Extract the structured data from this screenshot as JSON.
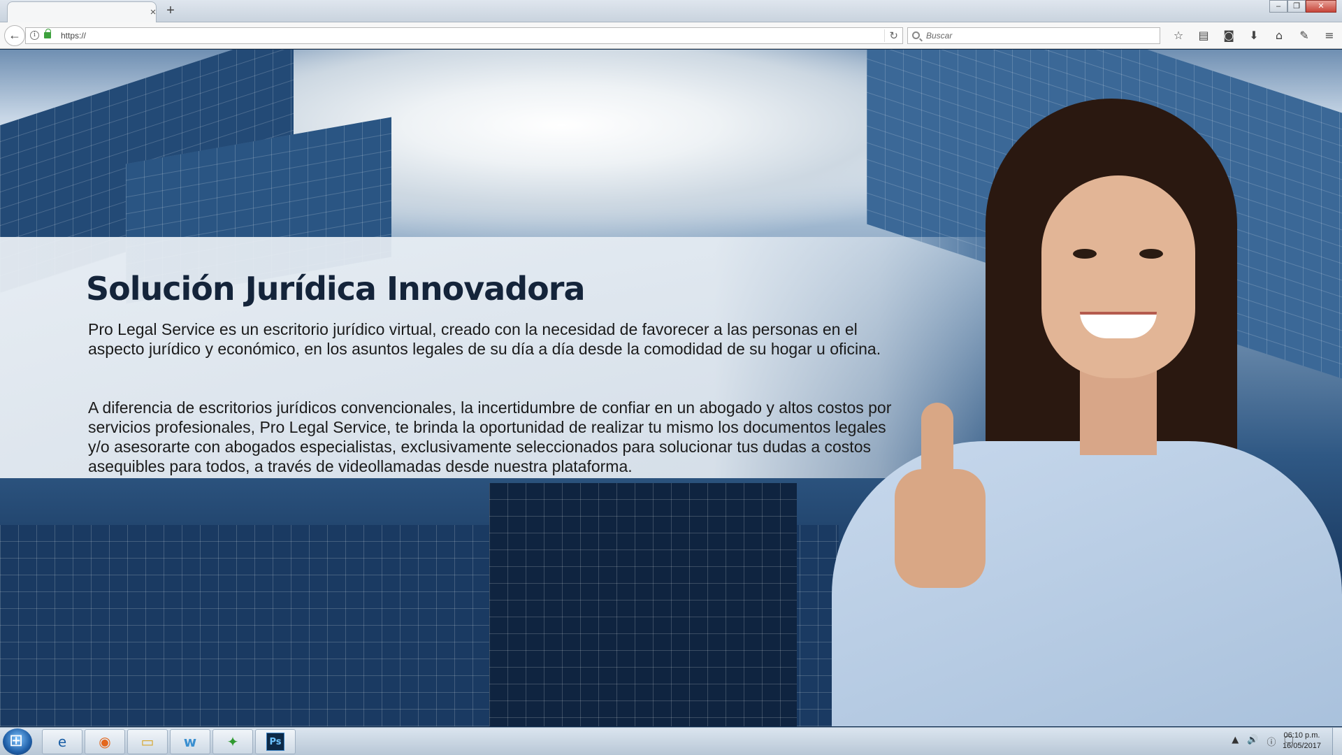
{
  "browser": {
    "tab_close": "×",
    "new_tab": "+",
    "window_buttons": {
      "minimize": "–",
      "maximize": "❐",
      "close": "✕"
    },
    "back": "←",
    "url": "https://",
    "reload": "↻",
    "search_placeholder": "Buscar",
    "toolbar_icons": [
      "☆",
      "▤",
      "◙",
      "⬇",
      "⌂",
      "✎",
      "≡"
    ]
  },
  "page": {
    "headline": "Solución Jurídica Innovadora",
    "paragraph1": "Pro Legal Service es un escritorio jurídico virtual, creado con la necesidad de favorecer a las personas en el aspecto jurídico y económico, en los asuntos legales de su día a día desde la comodidad de su hogar u oficina.",
    "paragraph2": "A diferencia de escritorios jurídicos convencionales, la incertidumbre de confiar en un abogado y altos costos por servicios profesionales, Pro Legal Service, te brinda la oportunidad de realizar tu mismo los documentos legales y/o asesorarte con abogados especialistas, exclusivamente seleccionados para solucionar tus dudas a costos asequibles para todos, a través de videollamadas desde nuestra plataforma."
  },
  "taskbar": {
    "apps": [
      {
        "name": "internet-explorer",
        "glyph": "e"
      },
      {
        "name": "firefox",
        "glyph": "◉"
      },
      {
        "name": "file-explorer",
        "glyph": "▭"
      },
      {
        "name": "w-app",
        "glyph": "w"
      },
      {
        "name": "green-app",
        "glyph": "✦"
      },
      {
        "name": "photoshop",
        "glyph": "Ps"
      }
    ],
    "tray_icons": [
      "▲",
      "🔊",
      "ⓘ",
      "🖵"
    ],
    "time": "06:10 p.m.",
    "date": "16/05/2017"
  }
}
